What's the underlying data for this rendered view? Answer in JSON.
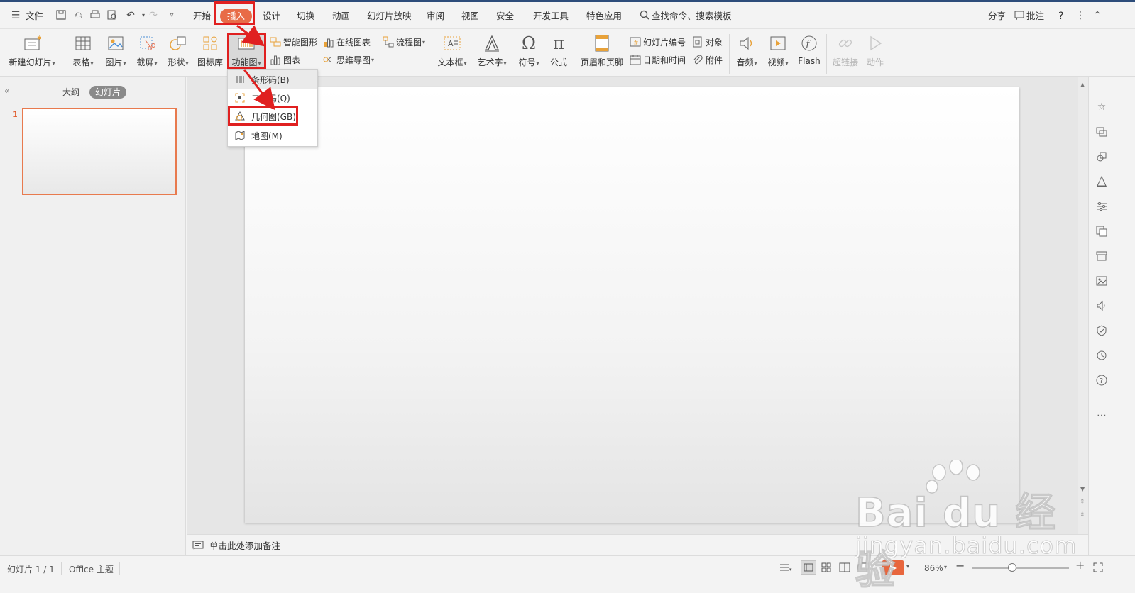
{
  "menubar": {
    "file_label": "文件",
    "tabs": [
      "开始",
      "插入",
      "设计",
      "切换",
      "动画",
      "幻灯片放映",
      "审阅",
      "视图",
      "安全",
      "开发工具",
      "特色应用"
    ],
    "active_tab": "插入",
    "search_label": "查找命令、搜索模板",
    "share_label": "分享",
    "comment_label": "批注",
    "help_label": "?"
  },
  "ribbon": {
    "new_slide": "新建幻灯片",
    "table": "表格",
    "picture": "图片",
    "screenshot": "截屏",
    "shape": "形状",
    "icon_library": "图标库",
    "function_chart": "功能图",
    "smart_art": "智能图形",
    "chart": "图表",
    "online_chart": "在线图表",
    "mind_map": "思维导图",
    "flowchart": "流程图",
    "textbox": "文本框",
    "wordart": "艺术字",
    "symbol": "符号",
    "formula": "公式",
    "header_footer": "页眉和页脚",
    "slide_number": "幻灯片编号",
    "datetime": "日期和时间",
    "object": "对象",
    "attachment": "附件",
    "audio": "音频",
    "video": "视频",
    "flash": "Flash",
    "hyperlink": "超链接",
    "action": "动作"
  },
  "dropdown": {
    "items": [
      {
        "label": "条形码(B)",
        "icon": "barcode-icon"
      },
      {
        "label": "二维码(Q)",
        "icon": "qrcode-icon"
      },
      {
        "label": "几何图(GB)",
        "icon": "geometry-icon"
      },
      {
        "label": "地图(M)",
        "icon": "map-icon"
      }
    ]
  },
  "left_pane": {
    "outline_tab": "大纲",
    "slides_tab": "幻灯片",
    "slide_number": "1"
  },
  "notes": {
    "placeholder": "单击此处添加备注"
  },
  "status": {
    "slide_info": "幻灯片 1 / 1",
    "theme": "Office 主题",
    "zoom": "86%"
  },
  "watermark": {
    "brand": "Bai du 经验",
    "url": "jingyan.baidu.com"
  },
  "colors": {
    "accent": "#e86b47",
    "highlight_red": "#e02020",
    "title_bar": "#2d4c7a",
    "play_button": "#e8663d"
  }
}
